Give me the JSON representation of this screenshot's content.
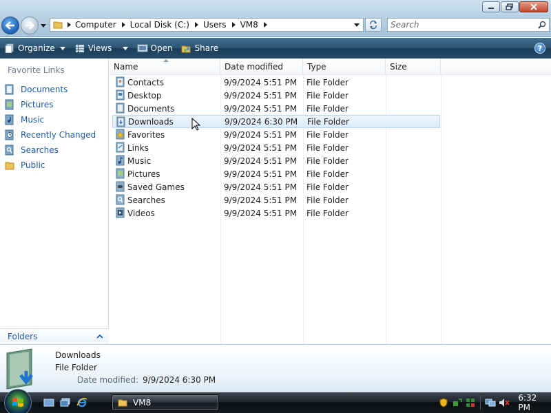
{
  "window": {
    "breadcrumbs": [
      "Computer",
      "Local Disk (C:)",
      "Users",
      "VM8"
    ],
    "search_placeholder": "Search"
  },
  "toolbar": {
    "organize_label": "Organize",
    "views_label": "Views",
    "open_label": "Open",
    "share_label": "Share",
    "help_label": "?"
  },
  "navpane": {
    "favorites_title": "Favorite Links",
    "items": [
      {
        "label": "Documents",
        "icon": "documents-icon"
      },
      {
        "label": "Pictures",
        "icon": "pictures-icon"
      },
      {
        "label": "Music",
        "icon": "music-icon"
      },
      {
        "label": "Recently Changed",
        "icon": "recently-changed-icon"
      },
      {
        "label": "Searches",
        "icon": "searches-icon"
      },
      {
        "label": "Public",
        "icon": "public-folder-icon"
      }
    ],
    "folders_label": "Folders"
  },
  "filelist": {
    "columns": [
      "Name",
      "Date modified",
      "Type",
      "Size"
    ],
    "rows": [
      {
        "name": "Contacts",
        "date": "9/9/2024 5:51 PM",
        "type": "File Folder"
      },
      {
        "name": "Desktop",
        "date": "9/9/2024 5:51 PM",
        "type": "File Folder"
      },
      {
        "name": "Documents",
        "date": "9/9/2024 5:51 PM",
        "type": "File Folder"
      },
      {
        "name": "Downloads",
        "date": "9/9/2024 6:30 PM",
        "type": "File Folder"
      },
      {
        "name": "Favorites",
        "date": "9/9/2024 5:51 PM",
        "type": "File Folder"
      },
      {
        "name": "Links",
        "date": "9/9/2024 5:51 PM",
        "type": "File Folder"
      },
      {
        "name": "Music",
        "date": "9/9/2024 5:51 PM",
        "type": "File Folder"
      },
      {
        "name": "Pictures",
        "date": "9/9/2024 5:51 PM",
        "type": "File Folder"
      },
      {
        "name": "Saved Games",
        "date": "9/9/2024 5:51 PM",
        "type": "File Folder"
      },
      {
        "name": "Searches",
        "date": "9/9/2024 5:51 PM",
        "type": "File Folder"
      },
      {
        "name": "Videos",
        "date": "9/9/2024 5:51 PM",
        "type": "File Folder"
      }
    ]
  },
  "details": {
    "name": "Downloads",
    "type": "File Folder",
    "modified_label": "Date modified:",
    "modified_value": "9/9/2024 6:30 PM"
  },
  "taskbar": {
    "window_button_label": "VM8",
    "clock": "6:32 PM"
  }
}
